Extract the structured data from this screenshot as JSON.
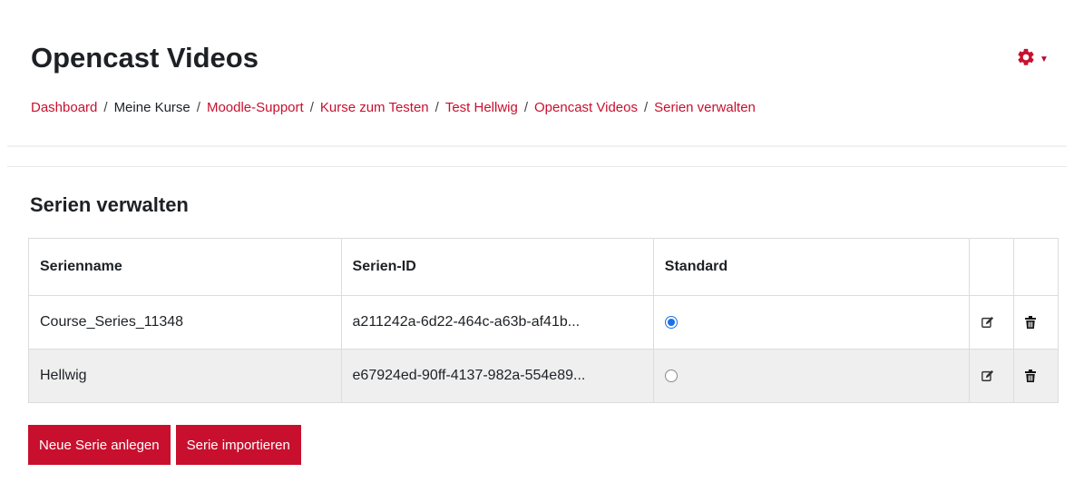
{
  "header": {
    "title": "Opencast Videos",
    "gear_icon": "gear-icon",
    "gear_color": "#c8102e"
  },
  "breadcrumb": [
    {
      "label": "Dashboard",
      "link": true
    },
    {
      "label": "Meine Kurse",
      "link": false
    },
    {
      "label": "Moodle-Support",
      "link": true
    },
    {
      "label": "Kurse zum Testen",
      "link": true
    },
    {
      "label": "Test Hellwig",
      "link": true
    },
    {
      "label": "Opencast Videos",
      "link": true
    },
    {
      "label": "Serien verwalten",
      "link": true
    }
  ],
  "section": {
    "heading": "Serien verwalten"
  },
  "table": {
    "headers": {
      "name": "Serienname",
      "id": "Serien-ID",
      "standard": "Standard"
    },
    "rows": [
      {
        "name": "Course_Series_11348",
        "id": "a211242a-6d22-464c-a63b-af41b...",
        "standard": true
      },
      {
        "name": "Hellwig",
        "id": "e67924ed-90ff-4137-982a-554e89...",
        "standard": false
      }
    ]
  },
  "actions": {
    "new_series": "Neue Serie anlegen",
    "import_series": "Serie importieren"
  },
  "colors": {
    "accent": "#c8102e",
    "radio_checked": "#1a73e8"
  }
}
